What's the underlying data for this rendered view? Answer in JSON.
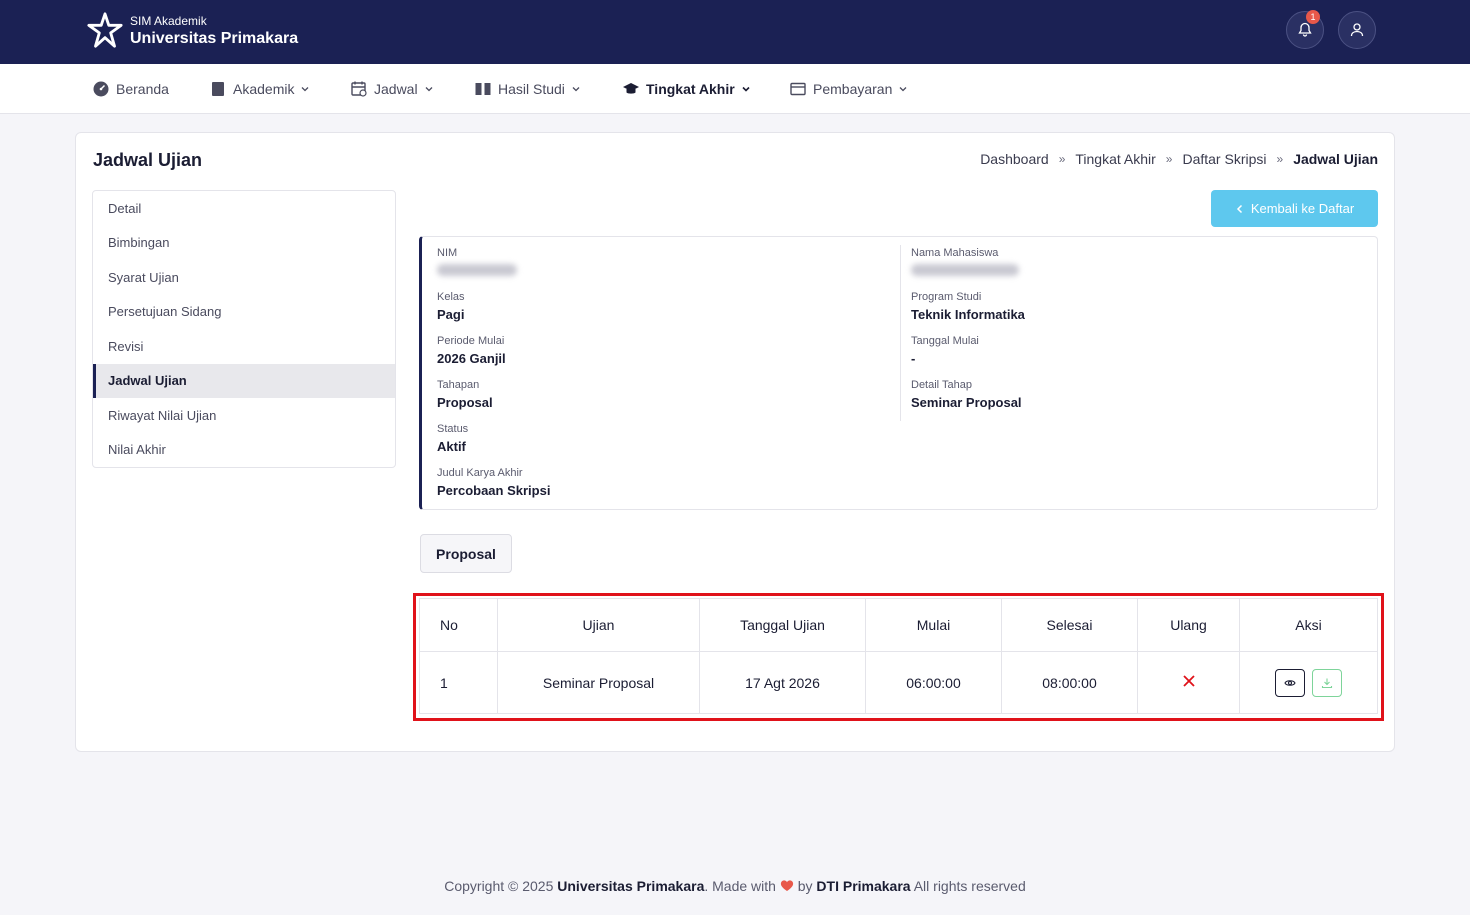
{
  "header": {
    "app_sub": "SIM Akademik",
    "app_title": "Universitas Primakara",
    "notif_count": "1"
  },
  "nav": {
    "items": [
      {
        "label": "Beranda",
        "icon": "dashboard-icon"
      },
      {
        "label": "Akademik",
        "icon": "book-icon"
      },
      {
        "label": "Jadwal",
        "icon": "calendar-icon"
      },
      {
        "label": "Hasil Studi",
        "icon": "open-book-icon"
      },
      {
        "label": "Tingkat Akhir",
        "icon": "graduation-cap-icon"
      },
      {
        "label": "Pembayaran",
        "icon": "wallet-icon"
      }
    ],
    "active": "Tingkat Akhir"
  },
  "page": {
    "title": "Jadwal Ujian",
    "breadcrumb": [
      "Dashboard",
      "Tingkat Akhir",
      "Daftar Skripsi",
      "Jadwal Ujian"
    ],
    "back_label": "Kembali ke Daftar"
  },
  "side_menu": {
    "items": [
      "Detail",
      "Bimbingan",
      "Syarat Ujian",
      "Persetujuan Sidang",
      "Revisi",
      "Jadwal Ujian",
      "Riwayat Nilai Ujian",
      "Nilai Akhir"
    ],
    "active": "Jadwal Ujian"
  },
  "info": {
    "nim_label": "NIM",
    "nama_label": "Nama Mahasiswa",
    "kelas_label": "Kelas",
    "kelas": "Pagi",
    "prodi_label": "Program Studi",
    "prodi": "Teknik Informatika",
    "periode_label": "Periode Mulai",
    "periode": "2026 Ganjil",
    "tgl_mulai_label": "Tanggal Mulai",
    "tgl_mulai": "-",
    "tahapan_label": "Tahapan",
    "tahapan": "Proposal",
    "detail_tahap_label": "Detail Tahap",
    "detail_tahap": "Seminar Proposal",
    "status_label": "Status",
    "status": "Aktif",
    "judul_label": "Judul Karya Akhir",
    "judul": "Percobaan Skripsi"
  },
  "tab": {
    "label": "Proposal"
  },
  "table": {
    "headers": [
      "No",
      "Ujian",
      "Tanggal Ujian",
      "Mulai",
      "Selesai",
      "Ulang",
      "Aksi"
    ],
    "rows": [
      {
        "no": "1",
        "ujian": "Seminar Proposal",
        "tanggal": "17 Agt 2026",
        "mulai": "06:00:00",
        "selesai": "08:00:00",
        "ulang_icon": "x-icon"
      }
    ]
  },
  "footer": {
    "prefix": "Copyright © 2025 ",
    "org": "Universitas Primakara",
    "made_with": ". Made with ",
    "by": " by ",
    "team": "DTI Primakara",
    "suffix": " All rights reserved"
  },
  "colors": {
    "header_bg": "#1b2154",
    "accent_button": "#5ec8ee",
    "highlight_border": "#e0121a",
    "heart": "#e8584a"
  }
}
